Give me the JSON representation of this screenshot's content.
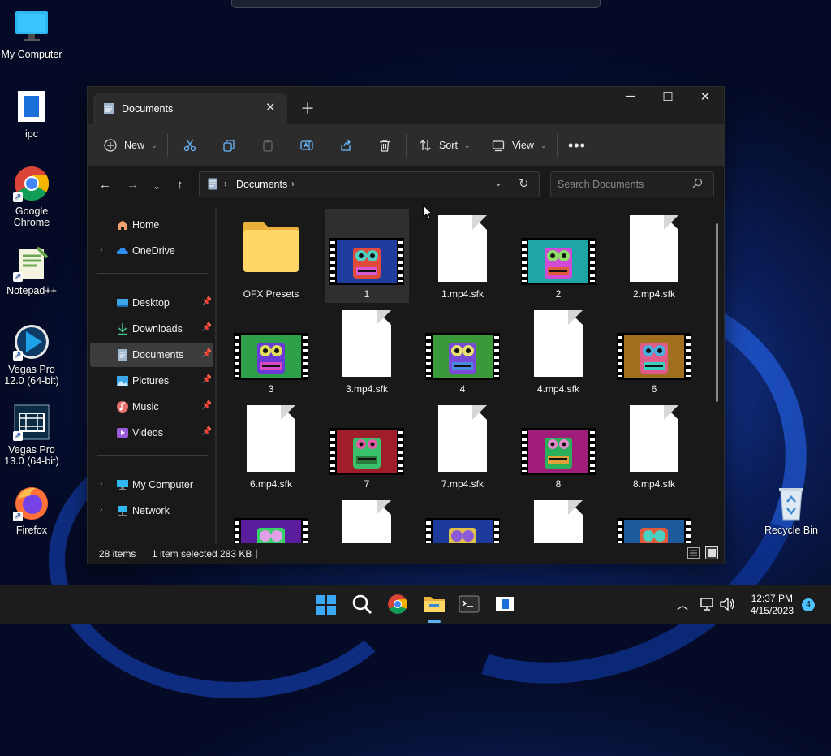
{
  "desktop": {
    "icons": [
      {
        "label": "My Computer"
      },
      {
        "label": "ipc"
      },
      {
        "label": "Google Chrome"
      },
      {
        "label": "Notepad++"
      },
      {
        "label": "Vegas Pro 12.0 (64-bit)"
      },
      {
        "label": "Vegas Pro 13.0 (64-bit)"
      },
      {
        "label": "Firefox"
      },
      {
        "label": "Recycle Bin"
      }
    ]
  },
  "window": {
    "tab_title": "Documents",
    "toolbar": {
      "new_label": "New",
      "sort_label": "Sort",
      "view_label": "View"
    },
    "address": {
      "crumbs": [
        "Documents"
      ],
      "search_placeholder": "Search Documents"
    },
    "sidebar": {
      "items": [
        {
          "label": "Home"
        },
        {
          "label": "OneDrive"
        },
        {
          "label": "Desktop"
        },
        {
          "label": "Downloads"
        },
        {
          "label": "Documents"
        },
        {
          "label": "Pictures"
        },
        {
          "label": "Music"
        },
        {
          "label": "Videos"
        },
        {
          "label": "My Computer"
        },
        {
          "label": "Network"
        }
      ]
    },
    "files": [
      {
        "name": "OFX Presets",
        "kind": "folder"
      },
      {
        "name": "1",
        "kind": "video",
        "selected": true
      },
      {
        "name": "1.mp4.sfk",
        "kind": "doc"
      },
      {
        "name": "2",
        "kind": "video"
      },
      {
        "name": "2.mp4.sfk",
        "kind": "doc"
      },
      {
        "name": "3",
        "kind": "video"
      },
      {
        "name": "3.mp4.sfk",
        "kind": "doc"
      },
      {
        "name": "4",
        "kind": "video"
      },
      {
        "name": "4.mp4.sfk",
        "kind": "doc"
      },
      {
        "name": "6",
        "kind": "video"
      },
      {
        "name": "6.mp4.sfk",
        "kind": "doc"
      },
      {
        "name": "7",
        "kind": "video"
      },
      {
        "name": "7.mp4.sfk",
        "kind": "doc"
      },
      {
        "name": "8",
        "kind": "video"
      },
      {
        "name": "8.mp4.sfk",
        "kind": "doc"
      }
    ],
    "status": {
      "items_count": "28 items",
      "selection": "1 item selected",
      "size": "283 KB"
    }
  },
  "taskbar": {
    "time": "12:37 PM",
    "date": "4/15/2023",
    "notification_count": "4"
  }
}
